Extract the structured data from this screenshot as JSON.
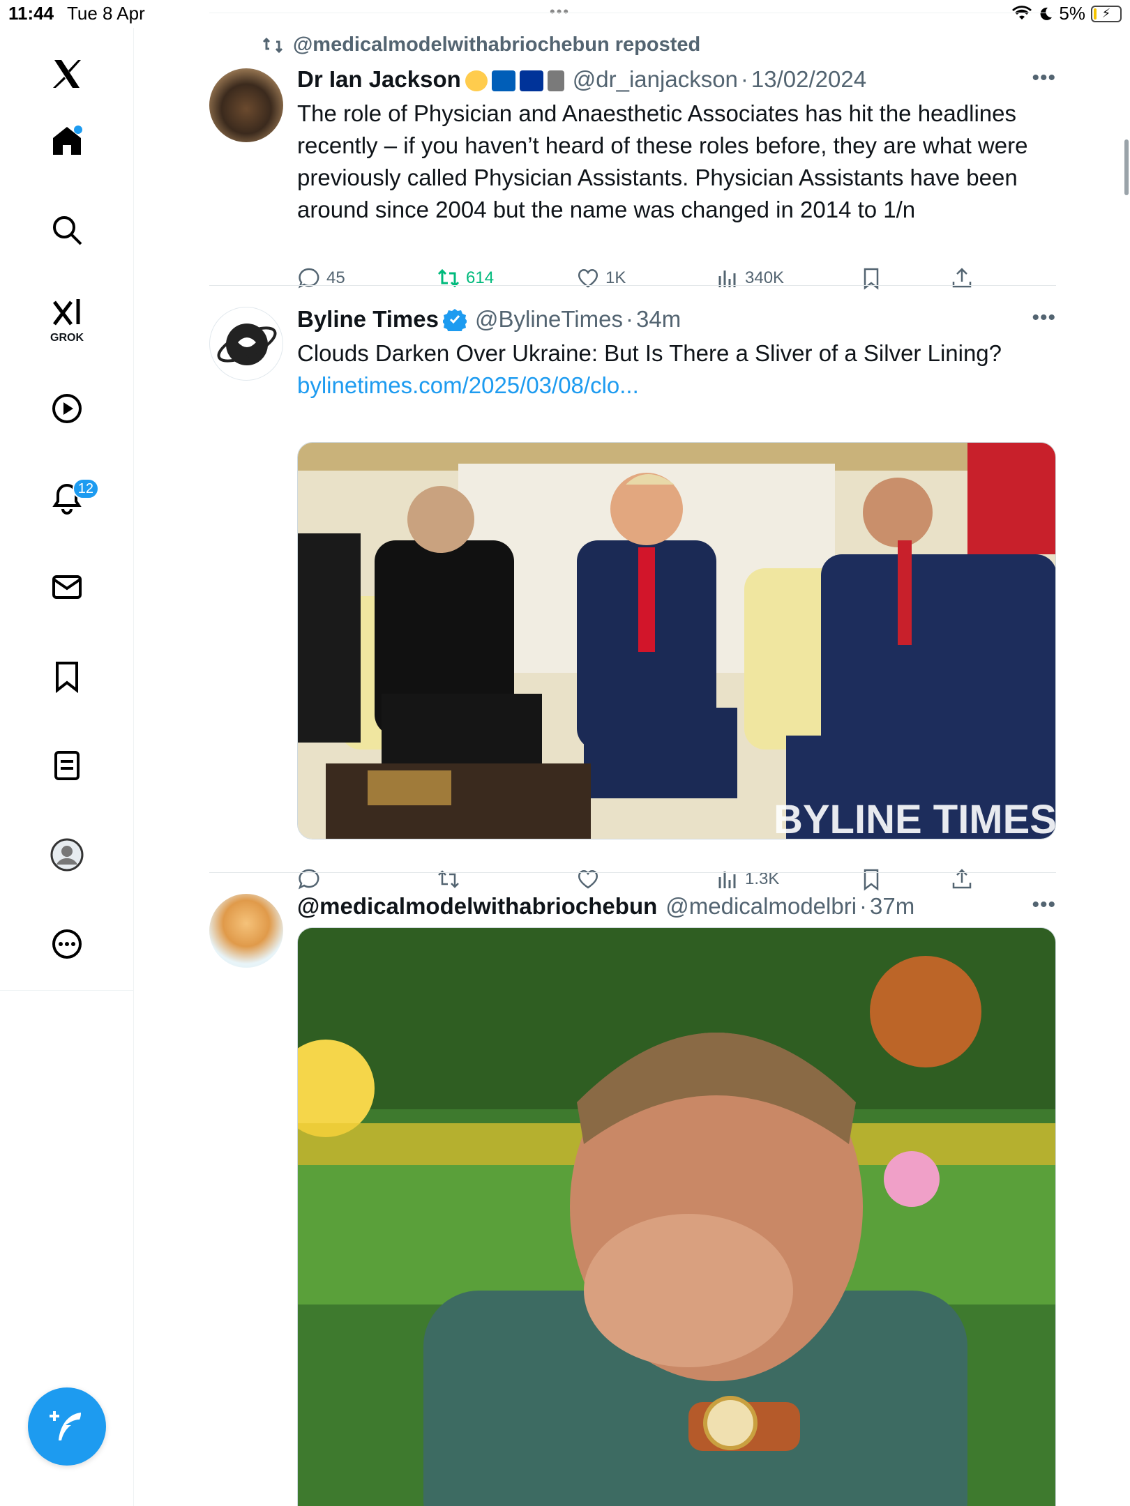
{
  "status_bar": {
    "time": "11:44",
    "date": "Tue 8 Apr",
    "battery": "5%"
  },
  "sidebar": {
    "items": [
      {
        "name": "x-logo"
      },
      {
        "name": "home"
      },
      {
        "name": "search"
      },
      {
        "name": "grok",
        "label": "GROK"
      },
      {
        "name": "video"
      },
      {
        "name": "notifications",
        "badge": "12"
      },
      {
        "name": "messages"
      },
      {
        "name": "bookmarks"
      },
      {
        "name": "lists"
      },
      {
        "name": "profile"
      },
      {
        "name": "more"
      }
    ]
  },
  "tweets": [
    {
      "repost_by": "@medicalmodelwithabriochebun reposted",
      "name": "Dr Ian Jackson",
      "handle": "@dr_ianjackson",
      "time": "13/02/2024",
      "text": "The role of Physician and Anaesthetic Associates has hit the headlines recently – if you haven’t heard of these roles before, they are what were previously called Physician Assistants. Physician Assistants have been around since 2004 but the name was changed in 2014 to 1/n",
      "replies": "45",
      "reposts": "614",
      "likes": "1K",
      "views": "340K"
    },
    {
      "name": "Byline Times",
      "handle": "@BylineTimes",
      "time": "34m",
      "text": "Clouds Darken Over Ukraine: But Is There a Sliver of a Silver Lining?",
      "link": "bylinetimes.com/2025/03/08/clo...",
      "image_watermark": "BYLINE TIMES",
      "views": "1.3K"
    },
    {
      "name": "@medicalmodelwithabriochebun",
      "handle": "@medicalmodelbri",
      "time": "37m"
    }
  ],
  "colors": {
    "accent": "#1d9bf0",
    "repost_green": "#00ba7c",
    "muted": "#536471"
  }
}
